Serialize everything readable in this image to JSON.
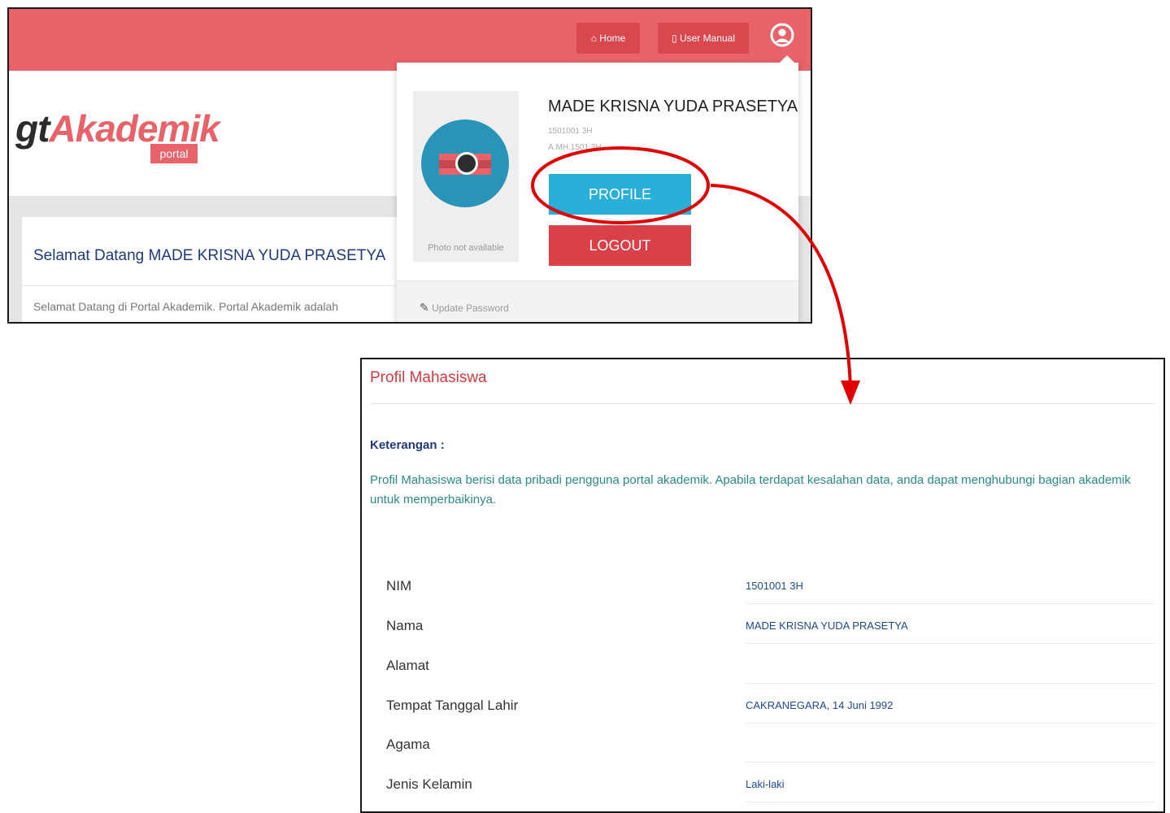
{
  "top": {
    "nav": {
      "home": "⌂ Home",
      "manual": "▯ User Manual"
    },
    "logo": {
      "gt": "gt",
      "akademik": "Akademik",
      "portal": "portal"
    },
    "welcome": {
      "title": "Selamat Datang MADE KRISNA YUDA PRASETYA",
      "text": "Selamat Datang di Portal Akademik. Portal Akademik adalah"
    },
    "dropdown": {
      "name": "MADE KRISNA YUDA PRASETYA",
      "nim": "1501001 3H",
      "code": "A.MH.1501 3H",
      "photo_caption": "Photo not available",
      "profile_button": "PROFILE",
      "logout_button": "LOGOUT",
      "update_password": "Update Password"
    }
  },
  "profil": {
    "title": "Profil Mahasiswa",
    "keterangan_label": "Keterangan :",
    "description": "Profil Mahasiswa berisi data pribadi pengguna portal akademik. Apabila terdapat kesalahan data, anda dapat menghubungi bagian akademik untuk memperbaikinya.",
    "rows": [
      {
        "label": "NIM",
        "value": "1501001 3H"
      },
      {
        "label": "Nama",
        "value": "MADE KRISNA YUDA PRASETYA"
      },
      {
        "label": "Alamat",
        "value": ""
      },
      {
        "label": "Tempat Tanggal Lahir",
        "value": "CAKRANEGARA, 14 Juni 1992"
      },
      {
        "label": "Agama",
        "value": ""
      },
      {
        "label": "Jenis Kelamin",
        "value": "Laki-laki"
      }
    ]
  },
  "colors": {
    "accent": "#e8626a",
    "profile_button": "#2ab0d8",
    "logout_button": "#d94048",
    "annotation": "#e00000"
  },
  "icons": {
    "user": "user-circle-icon",
    "edit": "edit-icon",
    "camera": "camera-icon"
  }
}
